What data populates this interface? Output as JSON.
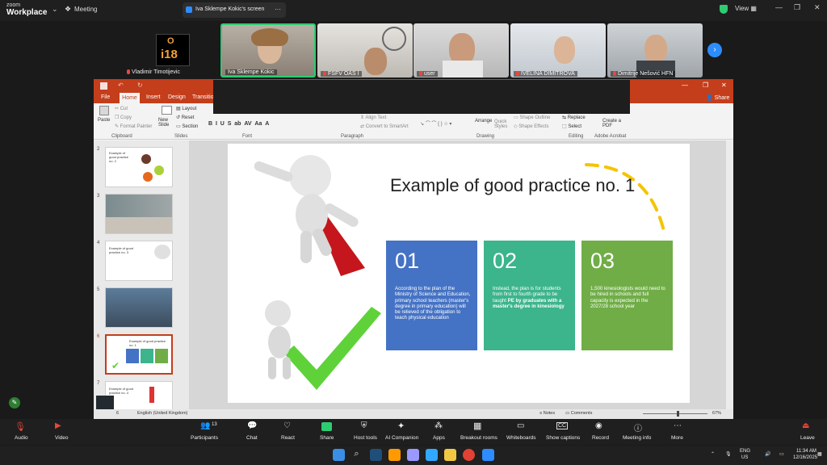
{
  "app": {
    "logo_line1": "zoom",
    "logo_line2": "Workplace",
    "meeting_label": "Meeting",
    "share_tab_label": "Iva Sklempe Kokic's screen",
    "view_label": "View"
  },
  "participants": [
    {
      "name": "Vladimir Timotijevic",
      "avatar_top": "O",
      "avatar_bottom": "i18"
    },
    {
      "name": "Iva Sklempe Kokic"
    },
    {
      "name": "FSFV OAS I"
    },
    {
      "name": "user"
    },
    {
      "name": "IVELINA DIMITROVA"
    },
    {
      "name": "Dimitrije Nešović HFN"
    }
  ],
  "ppt": {
    "tabs": [
      "File",
      "Home",
      "Insert",
      "Design",
      "Transitio"
    ],
    "share_label": "Share",
    "ribbon": {
      "paste": "Paste",
      "cut": "Cut",
      "copy": "Copy",
      "format_painter": "Format Painter",
      "new_slide": "New Slide",
      "layout": "Layout",
      "reset": "Reset",
      "section": "Section",
      "align_text": "Align Text",
      "convert_smartart": "Convert to SmartArt",
      "arrange": "Arrange",
      "quick_styles": "Quick Styles",
      "shape_outline": "Shape Outline",
      "shape_effects": "Shape Effects",
      "replace": "Replace",
      "select": "Select",
      "create_pdf": "Create a PDF",
      "groups": [
        "Clipboard",
        "Slides",
        "Font",
        "Paragraph",
        "Drawing",
        "Editing",
        "Adobe Acrobat"
      ]
    },
    "thumbnails": [
      {
        "num": "2",
        "title": "Example of good practice no. 2"
      },
      {
        "num": "3",
        "title": ""
      },
      {
        "num": "4",
        "title": "Example of good practice no. 3"
      },
      {
        "num": "5",
        "title": ""
      },
      {
        "num": "6",
        "title": "Example of good practice no. 1"
      },
      {
        "num": "7",
        "title": "Example of good practice no. 4"
      }
    ],
    "slide": {
      "title": "Example of good practice no. 1",
      "cards": [
        {
          "num": "01",
          "color": "#4472c4",
          "text": "According to the plan of the Ministry of Science and Education, primary school teachers (master's degree in primary education) will be relieved of the obligation to teach physical education"
        },
        {
          "num": "02",
          "color": "#3cb48c",
          "text_pre": "Instead, the plan is for students from first to fourth grade to be taught ",
          "text_bold": "PE by graduates with a master's degree in kinesiology"
        },
        {
          "num": "03",
          "color": "#70ad47",
          "text": "1,500 kinesiologists would need to be hired in schools and full capacity is expected in the 2027/28 school year"
        }
      ]
    },
    "status": {
      "slide_info": "6",
      "language": "English (United Kingdom)",
      "notes": "Notes",
      "comments": "Comments",
      "zoom": "67%"
    }
  },
  "toolbar": {
    "items": [
      "Audio",
      "Video",
      "Participants",
      "Chat",
      "React",
      "Share",
      "Host tools",
      "AI Companion",
      "Apps",
      "Breakout rooms",
      "Whiteboards",
      "Show captions",
      "Record",
      "Meeting info",
      "More",
      "Leave"
    ],
    "participants_count": "13"
  },
  "taskbar": {
    "lang": "ENG",
    "region": "US",
    "time": "11:34 AM",
    "date": "12/16/2025"
  },
  "colors": {
    "ppt_red": "#c43e1c",
    "zoom_blue": "#2d8cff",
    "leave_red": "#e8473d"
  }
}
